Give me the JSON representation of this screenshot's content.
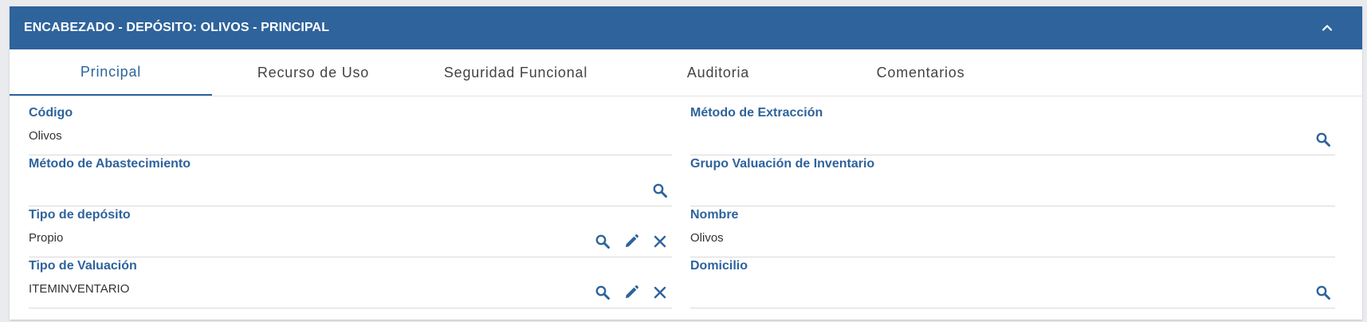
{
  "header": {
    "title": "ENCABEZADO - DEPÓSITO: OLIVOS - PRINCIPAL",
    "collapse_icon": "chevron-up-icon"
  },
  "tabs": [
    {
      "label": "Principal",
      "active": true
    },
    {
      "label": "Recurso de Uso",
      "active": false
    },
    {
      "label": "Seguridad Funcional",
      "active": false
    },
    {
      "label": "Auditoria",
      "active": false
    },
    {
      "label": "Comentarios",
      "active": false
    }
  ],
  "fields": {
    "codigo": {
      "label": "Código",
      "value": "Olivos"
    },
    "metodo_extraccion": {
      "label": "Método de Extracción",
      "value": ""
    },
    "metodo_abastecimiento": {
      "label": "Método de Abastecimiento",
      "value": ""
    },
    "grupo_valuacion": {
      "label": "Grupo Valuación de Inventario",
      "value": ""
    },
    "tipo_deposito": {
      "label": "Tipo de depósito",
      "value": "Propio"
    },
    "nombre": {
      "label": "Nombre",
      "value": "Olivos"
    },
    "tipo_valuacion": {
      "label": "Tipo de Valuación",
      "value": "ITEMINVENTARIO"
    },
    "domicilio": {
      "label": "Domicilio",
      "value": ""
    }
  },
  "icons": {
    "search": "search-icon",
    "edit": "pencil-icon",
    "clear": "close-icon"
  },
  "colors": {
    "primary": "#2e639c",
    "header_text": "#ffffff",
    "label": "#2e639c",
    "value": "#333333",
    "divider": "#d9d9d9"
  }
}
